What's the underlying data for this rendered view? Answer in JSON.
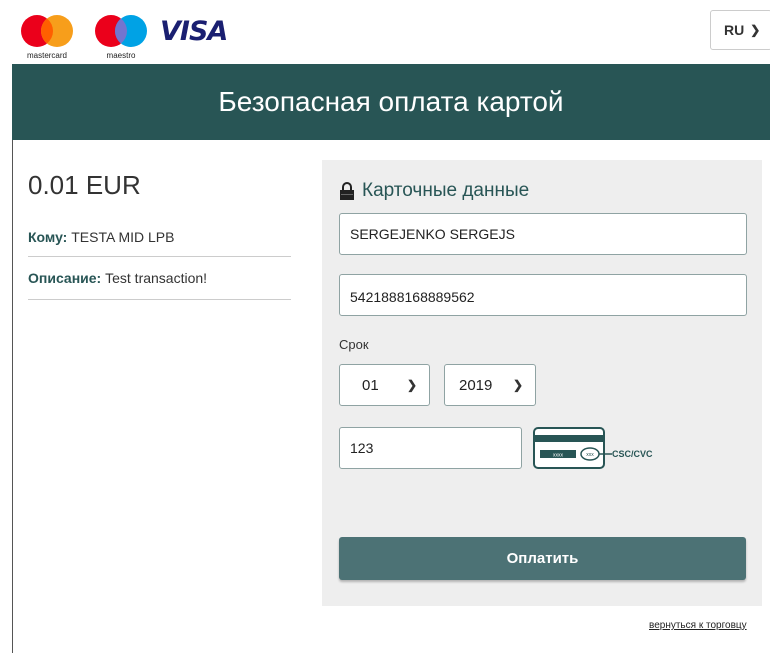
{
  "header": {
    "mastercard_label": "mastercard",
    "maestro_label": "maestro",
    "visa_label": "VISA",
    "language": "RU"
  },
  "banner": {
    "title": "Безопасная оплата картой"
  },
  "summary": {
    "amount": "0.01 EUR",
    "to_label": "Кому:",
    "to_value": "TESTA MID LPB",
    "desc_label": "Описание:",
    "desc_value": "Test transaction!"
  },
  "form": {
    "title": "Карточные данные",
    "cardholder_value": "SERGEJENKO SERGEJS",
    "card_number_value": "5421888168889562",
    "expiry_label": "Срок",
    "month_value": "01",
    "year_value": "2019",
    "cvc_value": "123",
    "cvc_hint": "CSC/CVC",
    "card_icon_digits": "xxxx",
    "card_icon_cvc": "xxx",
    "pay_button": "Оплатить"
  },
  "footer": {
    "back_link": "вернуться к торговцу"
  },
  "colors": {
    "brand": "#285555",
    "button": "#4c7275",
    "panel": "#eeeeee"
  }
}
